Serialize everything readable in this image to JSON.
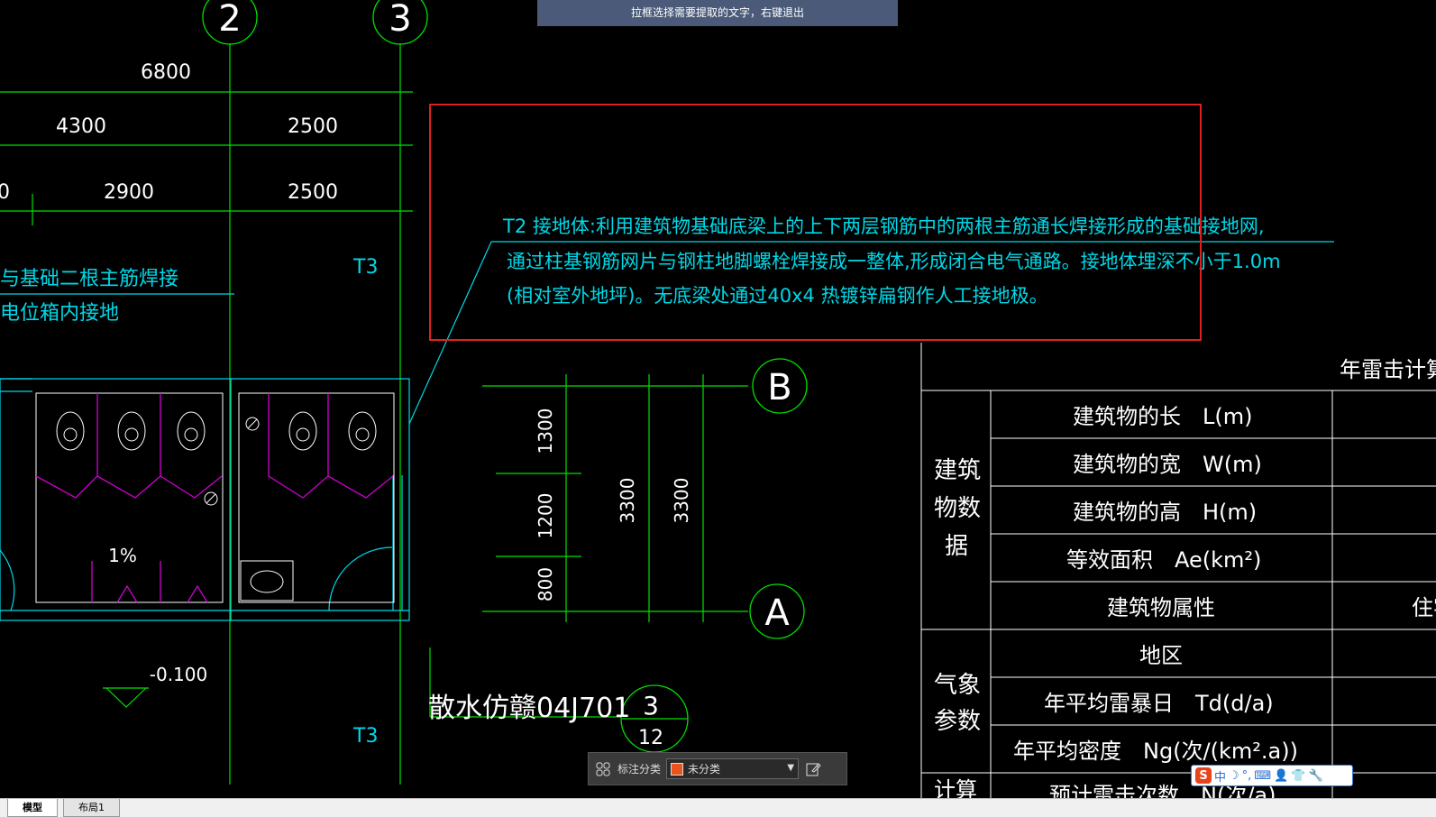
{
  "hint_bar": {
    "text": "拉框选择需要提取的文字，右键退出"
  },
  "grid_bubbles": {
    "b2": "2",
    "b3": "3",
    "bB": "B",
    "bA": "A",
    "section_top": "3",
    "section_bottom": "12"
  },
  "dimensions": {
    "d6800": "6800",
    "d4300": "4300",
    "d2500a": "2500",
    "d0": "0",
    "d2900": "2900",
    "d2500b": "2500",
    "d1300": "1300",
    "d1200": "1200",
    "d800": "800",
    "d3300a": "3300",
    "d3300b": "3300"
  },
  "labels": {
    "t3_upper": "T3",
    "t3_lower": "T3",
    "left_note_1": "与基础二根主筋焊接",
    "left_note_2": "电位箱内接地",
    "slope": "1%",
    "elevation": "-0.100",
    "apron": "散水仿赣04J701"
  },
  "note": {
    "line1": "T2 接地体:利用建筑物基础底梁上的上下两层钢筋中的两根主筋通长焊接形成的基础接地网,",
    "line2": "通过柱基钢筋网片与钢柱地脚螺栓焊接成一整体,形成闭合电气通路。接地体埋深不小于1.0m",
    "line3": "(相对室外地坪)。无底梁处通过40x4 热镀锌扁钢作人工接地极。"
  },
  "table": {
    "title": "年雷击计算表",
    "group_building": "建筑物数据",
    "group_weather": "气象参数",
    "group_calc": "计算",
    "rows": {
      "length": "建筑物的长　L(m)",
      "width": "建筑物的宽　W(m)",
      "height": "建筑物的高　H(m)",
      "area": "等效面积　Ae(km²)",
      "attr": "建筑物属性",
      "attr_val": "住宅",
      "region": "地区",
      "td": "年平均雷暴日　Td(d/a)",
      "ng": "年平均密度　Ng(次/(km².a))",
      "n": "预计雷击次数　N(次/a)"
    }
  },
  "toolbar": {
    "label": "标注分类",
    "selected": "未分类"
  },
  "ime": {
    "logo": "S",
    "mode": "中",
    "moon": "☽",
    "punct": "°,",
    "kbd": "⌨",
    "person": "👤",
    "shirt": "👕",
    "wrench": "🔧"
  },
  "tabs": {
    "model": "模型",
    "layout": "布局1"
  },
  "colors": {
    "green": "#00e000",
    "cyan": "#00d8e8",
    "magenta": "#d000d0",
    "white": "#ffffff",
    "red": "#e02020"
  }
}
